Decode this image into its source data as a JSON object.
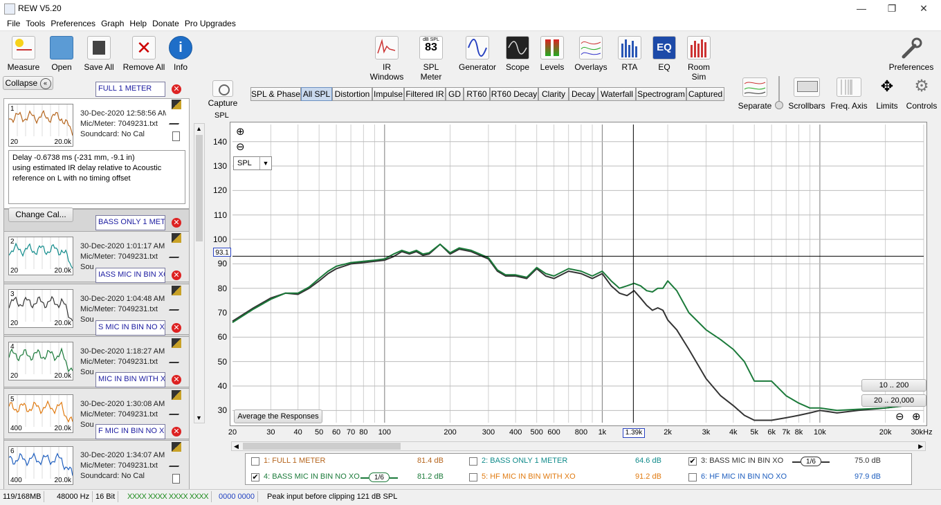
{
  "window": {
    "title": "REW V5.20",
    "minimize": "—",
    "restore": "❐",
    "close": "✕"
  },
  "menu": [
    "File",
    "Tools",
    "Preferences",
    "Graph",
    "Help",
    "Donate",
    "Pro Upgrades"
  ],
  "toolbar_left": [
    {
      "label": "Measure",
      "icon": "measure-icon"
    },
    {
      "label": "Open",
      "icon": "folder-icon"
    },
    {
      "label": "Save All",
      "icon": "save-all-icon"
    },
    {
      "label": "Remove All",
      "icon": "remove-all-icon"
    },
    {
      "label": "Info",
      "icon": "info-icon"
    }
  ],
  "toolbar_center": [
    {
      "label": "IR Windows",
      "icon": "ir-windows-icon"
    },
    {
      "label": "SPL Meter",
      "icon": "spl-meter-icon"
    },
    {
      "label": "Generator",
      "icon": "generator-icon"
    },
    {
      "label": "Scope",
      "icon": "scope-icon"
    },
    {
      "label": "Levels",
      "icon": "levels-icon"
    },
    {
      "label": "Overlays",
      "icon": "overlays-icon"
    },
    {
      "label": "RTA",
      "icon": "rta-icon"
    },
    {
      "label": "EQ",
      "icon": "eq-icon"
    },
    {
      "label": "Room Sim",
      "icon": "room-sim-icon"
    }
  ],
  "spl_meter_icon": {
    "top": "dB SPL",
    "value": "83"
  },
  "eq_icon_text": "EQ",
  "preferences_label": "Preferences",
  "collapse_label": "Collapse",
  "capture_label": "Capture",
  "graph_tabs": [
    "SPL & Phase",
    "All SPL",
    "Distortion",
    "Impulse",
    "Filtered IR",
    "GD",
    "RT60",
    "RT60 Decay",
    "Clarity",
    "Decay",
    "Waterfall",
    "Spectrogram",
    "Captured"
  ],
  "active_tab": "All SPL",
  "graph_controls": [
    "Separate",
    "Scrollbars",
    "Freq. Axis",
    "Limits",
    "Controls"
  ],
  "measurements": [
    {
      "index": "1",
      "name": "FULL 1 METER",
      "date": "30-Dec-2020 12:58:56 AM",
      "mic": "Mic/Meter: 7049231.txt",
      "soundcard": "Soundcard: No Cal",
      "thumb_lo": "20",
      "thumb_hi": "20.0k",
      "color": "#b5651d"
    },
    {
      "index": "2",
      "name": "BASS ONLY 1 MET",
      "date": "30-Dec-2020 1:01:17 AM",
      "mic": "Mic/Meter: 7049231.txt",
      "soundcard": "Sou",
      "thumb_lo": "20",
      "thumb_hi": "20.0k",
      "color": "#0e8a8a"
    },
    {
      "index": "3",
      "name": "IASS MIC IN BIN XO",
      "date": "30-Dec-2020 1:04:48 AM",
      "mic": "Mic/Meter: 7049231.txt",
      "soundcard": "Sou",
      "thumb_lo": "20",
      "thumb_hi": "20.0k",
      "color": "#333333"
    },
    {
      "index": "4",
      "name": "S MIC IN BIN NO XO",
      "date": "30-Dec-2020 1:18:27 AM",
      "mic": "Mic/Meter: 7049231.txt",
      "soundcard": "Sou",
      "thumb_lo": "20",
      "thumb_hi": "20.0k",
      "color": "#1b7a3a"
    },
    {
      "index": "5",
      "name": "MIC IN BIN WITH XO",
      "date": "30-Dec-2020 1:30:08 AM",
      "mic": "Mic/Meter: 7049231.txt",
      "soundcard": "Sou",
      "thumb_lo": "400",
      "thumb_hi": "20.0k",
      "color": "#e07a10"
    },
    {
      "index": "6",
      "name": "F MIC IN BIN NO XO",
      "date": "30-Dec-2020 1:34:07 AM",
      "mic": "Mic/Meter: 7049231.txt",
      "soundcard": "Soundcard: No Cal",
      "thumb_lo": "400",
      "thumb_hi": "20.0k",
      "color": "#1f5fbf"
    }
  ],
  "delay_note": [
    "Delay -0.6738 ms (-231 mm, -9.1 in)",
    "using estimated IR delay relative to Acoustic",
    "reference on  L with no timing offset"
  ],
  "change_cal_label": "Change Cal...",
  "plot": {
    "y_axis_name": "SPL",
    "y_ticks": [
      "140",
      "130",
      "120",
      "110",
      "100",
      "90",
      "80",
      "70",
      "60",
      "50",
      "40",
      "30"
    ],
    "x_ticks": [
      "20",
      "30",
      "40",
      "50",
      "60",
      "70",
      "80",
      "100",
      "200",
      "300",
      "400",
      "500",
      "600",
      "800",
      "1k",
      "2k",
      "3k",
      "4k",
      "5k",
      "6k",
      "7k",
      "8k",
      "10k",
      "20k",
      "30kHz"
    ],
    "cursor_y_value": "93.1",
    "cursor_x_value": "1.39k",
    "y_select": "SPL",
    "zoom_in": "⊕",
    "zoom_out": "⊖",
    "average_button": "Average the Responses",
    "range_button_1": "10 .. 200",
    "range_button_2": "20 .. 20,000"
  },
  "chart_data": {
    "type": "line",
    "title": "",
    "xlabel": "",
    "ylabel": "SPL",
    "xscale": "log",
    "xlim": [
      20,
      30000
    ],
    "ylim": [
      25,
      147
    ],
    "grid": true,
    "cursor": {
      "x": 1390,
      "y": 93.1
    },
    "series": [
      {
        "name": "3: BASS MIC IN BIN XO",
        "color": "#333333",
        "x": [
          20,
          25,
          30,
          35,
          40,
          45,
          50,
          55,
          60,
          70,
          80,
          90,
          100,
          110,
          120,
          130,
          140,
          150,
          160,
          180,
          200,
          220,
          250,
          300,
          330,
          360,
          400,
          450,
          500,
          550,
          600,
          700,
          800,
          900,
          1000,
          1100,
          1200,
          1300,
          1400,
          1500,
          1600,
          1700,
          1800,
          1900,
          2000,
          2200,
          2500,
          3000,
          3500,
          4000,
          4500,
          5000,
          6000,
          7000,
          8000,
          9000,
          10000,
          12000,
          15000,
          20000,
          25000
        ],
        "y": [
          66.5,
          72,
          76,
          78,
          77.5,
          80,
          83,
          86,
          88,
          90,
          90.5,
          91,
          91.5,
          93,
          95,
          94,
          95,
          93.5,
          94,
          98,
          94,
          96,
          95,
          92,
          87,
          85,
          85,
          84,
          88,
          85,
          84,
          87,
          86,
          84,
          86,
          81,
          78,
          77,
          79,
          76,
          73,
          71,
          72,
          71,
          67,
          63,
          55,
          43,
          36,
          32,
          28,
          26,
          26,
          27,
          28,
          29,
          30,
          29,
          30,
          31,
          32
        ]
      },
      {
        "name": "4: BASS MIC IN BIN NO XO",
        "color": "#1b7a3a",
        "x": [
          20,
          25,
          30,
          35,
          40,
          45,
          50,
          55,
          60,
          70,
          80,
          90,
          100,
          110,
          120,
          130,
          140,
          150,
          160,
          180,
          200,
          220,
          250,
          300,
          330,
          360,
          400,
          450,
          500,
          550,
          600,
          700,
          800,
          900,
          1000,
          1100,
          1200,
          1300,
          1400,
          1500,
          1600,
          1700,
          1800,
          1900,
          2000,
          2200,
          2500,
          3000,
          3500,
          4000,
          4500,
          5000,
          6000,
          7000,
          8000,
          9000,
          10000,
          12000,
          15000,
          20000,
          25000
        ],
        "y": [
          66,
          71.5,
          75.5,
          78,
          78,
          80.5,
          84,
          87,
          89,
          90.5,
          91,
          91.5,
          92,
          94,
          95.5,
          94.5,
          95.5,
          94,
          94.5,
          98,
          94.5,
          96.5,
          95.5,
          92.5,
          87.5,
          85.5,
          85.5,
          84.5,
          88.5,
          86,
          85,
          88,
          87,
          85,
          87,
          83,
          80,
          81,
          82,
          81,
          79,
          78.5,
          80,
          80,
          83,
          79,
          70,
          63,
          59,
          55,
          50,
          42,
          42,
          36,
          33,
          31,
          31,
          30,
          30.5,
          31,
          32
        ]
      }
    ]
  },
  "legend": [
    {
      "label": "1: FULL 1 METER",
      "value": "81.4 dB",
      "checked": false,
      "color": "#b5651d",
      "smoothing": ""
    },
    {
      "label": "2: BASS ONLY 1 METER",
      "value": "64.6 dB",
      "checked": false,
      "color": "#0e8a8a",
      "smoothing": ""
    },
    {
      "label": "3: BASS MIC IN BIN XO",
      "value": "75.0 dB",
      "checked": true,
      "color": "#333333",
      "smoothing": "1/6"
    },
    {
      "label": "4: BASS MIC IN BIN NO XO",
      "value": "81.2 dB",
      "checked": true,
      "color": "#1b7a3a",
      "smoothing": "1/6"
    },
    {
      "label": "5: HF MIC IN BIN WITH XO",
      "value": "91.2 dB",
      "checked": false,
      "color": "#e07a10",
      "smoothing": ""
    },
    {
      "label": "6: HF MIC IN BIN NO XO",
      "value": "97.9 dB",
      "checked": false,
      "color": "#1f5fbf",
      "smoothing": ""
    }
  ],
  "status": {
    "memory": "119/168MB",
    "rate": "48000 Hz",
    "bits": "16 Bit",
    "in_levels": "XXXX XXXX   XXXX XXXX",
    "out_levels": "0000 0000",
    "clip": "Peak input before clipping 121 dB SPL"
  }
}
